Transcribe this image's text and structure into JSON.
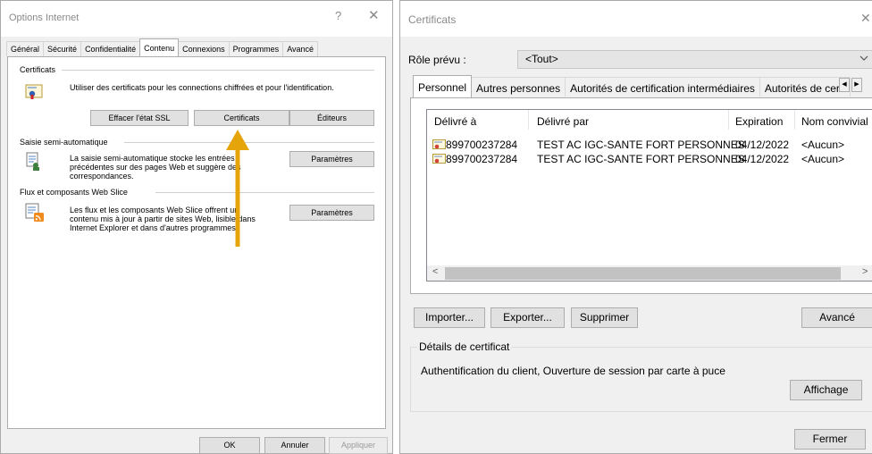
{
  "options_dialog": {
    "title": "Options Internet",
    "help_glyph": "?",
    "close_glyph": "✕",
    "tabs": [
      "Général",
      "Sécurité",
      "Confidentialité",
      "Contenu",
      "Connexions",
      "Programmes",
      "Avancé"
    ],
    "active_tab": "Contenu",
    "certificates_group": {
      "label": "Certificats",
      "description": "Utiliser des certificats pour les connections chiffrées et pour l'identification.",
      "buttons": {
        "clear_ssl": "Effacer l'état SSL",
        "certificates": "Certificats",
        "publishers": "Éditeurs"
      }
    },
    "autocomplete_group": {
      "label": "Saisie semi-automatique",
      "description": [
        "La saisie semi-automatique stocke les entrées",
        "précédentes sur des pages Web et suggère des",
        "correspondances."
      ],
      "settings_button": "Paramètres"
    },
    "feeds_group": {
      "label": "Flux et composants Web Slice",
      "description": [
        "Les flux et les composants Web Slice offrent un",
        "contenu mis à jour à partir de sites Web, lisible dans",
        "Internet Explorer et dans d'autres programmes."
      ],
      "settings_button": "Paramètres"
    },
    "footer": {
      "ok": "OK",
      "cancel": "Annuler",
      "apply": "Appliquer"
    },
    "annotation_arrow_color": "#e5a50a"
  },
  "certificates_dialog": {
    "title": "Certificats",
    "close_glyph": "✕",
    "role_label": "Rôle prévu :",
    "role_value": "<Tout>",
    "tabs": [
      "Personnel",
      "Autres personnes",
      "Autorités de certification intermédiaires",
      "Autorités de certi"
    ],
    "active_tab": "Personnel",
    "tab_scroll": {
      "left": "◀",
      "right": "▶"
    },
    "columns": [
      "Délivré à",
      "Délivré par",
      "Expiration",
      "Nom convivial"
    ],
    "rows": [
      {
        "issued_to": "899700237284",
        "issued_by": "TEST AC IGC-SANTE FORT PERSONNES",
        "expiration": "04/12/2022",
        "friendly_name": "<Aucun>"
      },
      {
        "issued_to": "899700237284",
        "issued_by": "TEST AC IGC-SANTE FORT PERSONNES",
        "expiration": "04/12/2022",
        "friendly_name": "<Aucun>"
      }
    ],
    "scroll_glyphs": {
      "left": "<",
      "right": ">"
    },
    "buttons": {
      "import": "Importer...",
      "export": "Exporter...",
      "remove": "Supprimer",
      "advanced": "Avancé"
    },
    "details": {
      "label": "Détails de certificat",
      "text": "Authentification du client, Ouverture de session par carte à puce",
      "view_button": "Affichage"
    },
    "close_button": "Fermer"
  }
}
